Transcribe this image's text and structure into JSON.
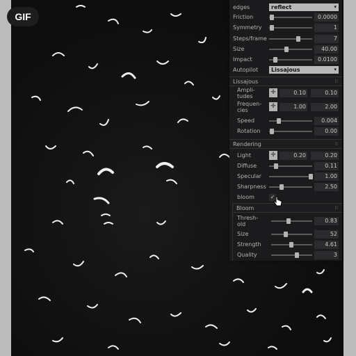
{
  "badge": "GIF",
  "panel": {
    "rows": [
      {
        "label": "edges",
        "value": "reflect"
      },
      {
        "label": "Friction",
        "value": "0.0000",
        "fill": 0.0
      },
      {
        "label": "Symmetry",
        "value": "1",
        "fill": 0.0
      },
      {
        "label": "Steps/frame",
        "value": "7",
        "fill": 0.62
      },
      {
        "label": "Size",
        "value": "40.00",
        "fill": 0.36
      },
      {
        "label": "Impact",
        "value": "0.0100",
        "fill": 0.1
      },
      {
        "label": "Autopilot",
        "value": "Lissajous"
      }
    ],
    "lissajous": {
      "title": "Lissajous",
      "amplitudes": {
        "label1": "Ampli-",
        "label2": "tudes",
        "x": "0.10",
        "y": "0.10"
      },
      "frequencies": {
        "label1": "Frequen-",
        "label2": "cies",
        "x": "1.00",
        "y": "2.00"
      },
      "speed": {
        "label": "Speed",
        "value": "0.004",
        "fill": 0.2
      },
      "rotation": {
        "label": "Rotation",
        "value": "0.00",
        "fill": 0.0
      }
    },
    "rendering": {
      "title": "Rendering",
      "light": {
        "label": "Light",
        "x": "0.20",
        "y": "0.20"
      },
      "diffuse": {
        "label": "Diffuse",
        "value": "0.11",
        "fill": 0.11
      },
      "specular": {
        "label": "Specular",
        "value": "1.00",
        "fill": 1.0
      },
      "sharpness": {
        "label": "Sharpness",
        "value": "2.50",
        "fill": 0.25
      },
      "bloom": {
        "label": "bloom",
        "checked": true
      }
    },
    "bloom": {
      "title": "Bloom",
      "threshold": {
        "label1": "Thresh-",
        "label2": "old",
        "value": "0.83",
        "fill": 0.45
      },
      "size": {
        "label": "Size",
        "value": "52",
        "fill": 0.35
      },
      "strength": {
        "label": "Strength",
        "value": "4.61",
        "fill": 0.52
      },
      "quality": {
        "label": "Quality",
        "value": "3",
        "fill": 0.72
      }
    }
  },
  "icons": {
    "pad": "crosshair-icon",
    "check": "check-icon",
    "cursor": "hand-pointer-icon"
  }
}
